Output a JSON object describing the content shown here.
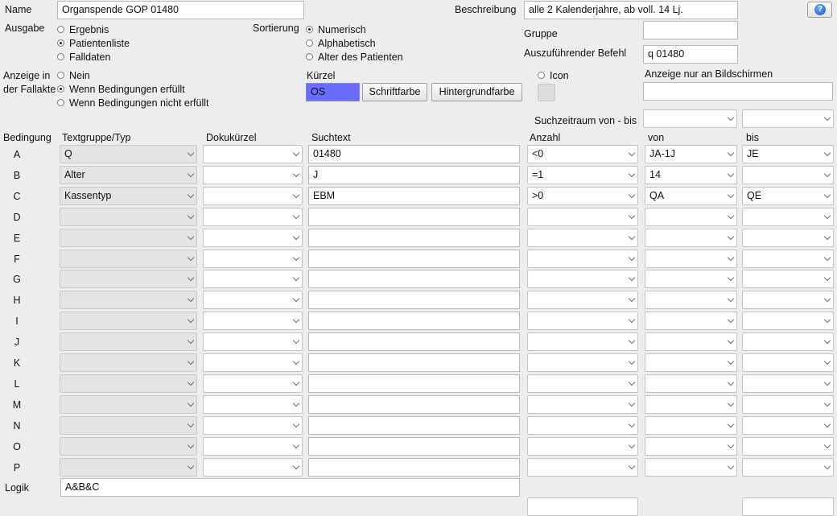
{
  "header": {
    "name_label": "Name",
    "name_value": "Organspende GOP 01480",
    "beschreibung_label": "Beschreibung",
    "beschreibung_value": "alle 2 Kalenderjahre, ab voll. 14 Lj.",
    "help_icon": "help-question-icon"
  },
  "ausgabe": {
    "label": "Ausgabe",
    "options": [
      {
        "label": "Ergebnis",
        "selected": false
      },
      {
        "label": "Patientenliste",
        "selected": true
      },
      {
        "label": "Falldaten",
        "selected": false
      }
    ]
  },
  "sortierung": {
    "label": "Sortierung",
    "options": [
      {
        "label": "Numerisch",
        "selected": true
      },
      {
        "label": "Alphabetisch",
        "selected": false
      },
      {
        "label": "Alter des Patienten",
        "selected": false
      }
    ]
  },
  "gruppe": {
    "label": "Gruppe",
    "value": ""
  },
  "befehl": {
    "label": "Auszuführender Befehl",
    "value": "q 01480"
  },
  "anzeige": {
    "label_line1": "Anzeige in",
    "label_line2": "der Fallakte",
    "options": [
      {
        "label": "Nein",
        "selected": false
      },
      {
        "label": "Wenn Bedingungen erfüllt",
        "selected": true
      },
      {
        "label": "Wenn Bedingungen nicht erfüllt",
        "selected": false
      }
    ]
  },
  "kurzel": {
    "label": "Kürzel",
    "value": "OS",
    "swatch_color": "#6b6bff",
    "schriftfarbe_button": "Schriftfarbe",
    "hintergrundfarbe_button": "Hintergrundfarbe"
  },
  "icon_option": {
    "label": "Icon",
    "selected": false
  },
  "bildschirme": {
    "label": "Anzeige nur an Bildschirmen",
    "value": ""
  },
  "suchzeitraum": {
    "label": "Suchzeitraum von - bis",
    "von": "",
    "bis": ""
  },
  "table": {
    "headers": {
      "bedingung": "Bedingung",
      "textgruppe": "Textgruppe/Typ",
      "dokukuerzel": "Dokukürzel",
      "suchtext": "Suchtext",
      "anzahl": "Anzahl",
      "von": "von",
      "bis": "bis"
    },
    "rows": [
      {
        "letter": "A",
        "textgruppe": "Q",
        "doku": "",
        "suchtext": "01480",
        "anzahl": "<0",
        "von": "JA-1J",
        "bis": "JE"
      },
      {
        "letter": "B",
        "textgruppe": "Alter",
        "doku": "",
        "suchtext": "J",
        "anzahl": "=1",
        "von": "14",
        "bis": ""
      },
      {
        "letter": "C",
        "textgruppe": "Kassentyp",
        "doku": "",
        "suchtext": "EBM",
        "anzahl": ">0",
        "von": "QA",
        "bis": "QE"
      },
      {
        "letter": "D",
        "textgruppe": "",
        "doku": "",
        "suchtext": "",
        "anzahl": "",
        "von": "",
        "bis": ""
      },
      {
        "letter": "E",
        "textgruppe": "",
        "doku": "",
        "suchtext": "",
        "anzahl": "",
        "von": "",
        "bis": ""
      },
      {
        "letter": "F",
        "textgruppe": "",
        "doku": "",
        "suchtext": "",
        "anzahl": "",
        "von": "",
        "bis": ""
      },
      {
        "letter": "G",
        "textgruppe": "",
        "doku": "",
        "suchtext": "",
        "anzahl": "",
        "von": "",
        "bis": ""
      },
      {
        "letter": "H",
        "textgruppe": "",
        "doku": "",
        "suchtext": "",
        "anzahl": "",
        "von": "",
        "bis": ""
      },
      {
        "letter": "I",
        "textgruppe": "",
        "doku": "",
        "suchtext": "",
        "anzahl": "",
        "von": "",
        "bis": ""
      },
      {
        "letter": "J",
        "textgruppe": "",
        "doku": "",
        "suchtext": "",
        "anzahl": "",
        "von": "",
        "bis": ""
      },
      {
        "letter": "K",
        "textgruppe": "",
        "doku": "",
        "suchtext": "",
        "anzahl": "",
        "von": "",
        "bis": ""
      },
      {
        "letter": "L",
        "textgruppe": "",
        "doku": "",
        "suchtext": "",
        "anzahl": "",
        "von": "",
        "bis": ""
      },
      {
        "letter": "M",
        "textgruppe": "",
        "doku": "",
        "suchtext": "",
        "anzahl": "",
        "von": "",
        "bis": ""
      },
      {
        "letter": "N",
        "textgruppe": "",
        "doku": "",
        "suchtext": "",
        "anzahl": "",
        "von": "",
        "bis": ""
      },
      {
        "letter": "O",
        "textgruppe": "",
        "doku": "",
        "suchtext": "",
        "anzahl": "",
        "von": "",
        "bis": ""
      },
      {
        "letter": "P",
        "textgruppe": "",
        "doku": "",
        "suchtext": "",
        "anzahl": "",
        "von": "",
        "bis": ""
      }
    ]
  },
  "logik": {
    "label": "Logik",
    "value": "A&B&C"
  }
}
